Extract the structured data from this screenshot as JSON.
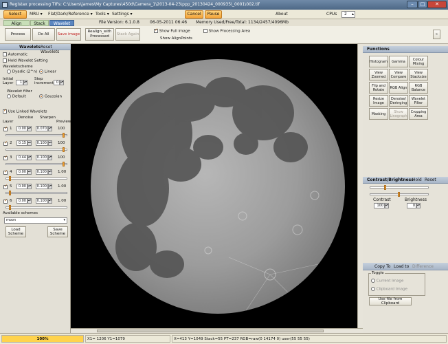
{
  "window": {
    "title": "Registax processing TIFs: C:\\Users\\james\\My Captures\\450d\\Camera_1\\2013-04-23\\ppp_20130424_000935\\_0001\\002.tif"
  },
  "menubar": {
    "select": "Select",
    "mru": "MRU",
    "flat": "Flat/Dark/Reference",
    "tools": "Tools",
    "settings": "Settings",
    "cancel": "Cancel",
    "pause": "Pause",
    "about": "About",
    "cpus_label": "CPUs",
    "cpus_value": "2"
  },
  "tabs": {
    "align": "Align",
    "stack": "Stack",
    "wavelet": "Wavelet",
    "file_version": "File Version: 6.1.0.8",
    "file_date": "06-05-2011 06:46",
    "memory": "Memory Used/Free/Total: 1134/2457/4096Mb"
  },
  "toolbar": {
    "process": "Process",
    "do_all": "Do All",
    "save_image": "Save image",
    "realign": "Realign_with Processed",
    "stack_again": "Stack Again",
    "show_full_image": "Show Full image",
    "show_processing_area": "Show Processing Area",
    "show_alignpoints": "Show AlignPoints",
    "expand": "»"
  },
  "wavelets": {
    "header": "Wavelets",
    "reset": "Reset Wavelets",
    "automatic": "Automatic",
    "hold_wavelet": "Hold Wavelet Setting",
    "scheme_label": "Waveletscheme",
    "dyadic": "Dyadic (2^n)",
    "linear": "Linear",
    "initial_layer_label": "Initial Layer",
    "initial_layer_value": "1",
    "step_increment_label": "Step increment",
    "step_increment_value": "0",
    "filter_label": "Wavelet filter",
    "default": "Default",
    "gaussian": "Gaussian",
    "use_linked": "Use Linked Wavelets",
    "col_layer": "Layer",
    "col_denoise": "Denoise",
    "col_sharpen": "Sharpen",
    "col_preview": "Preview",
    "layers": [
      {
        "n": "1",
        "denoise": "0.00",
        "sharpen": "0.070",
        "preview": "100",
        "level": 0.95
      },
      {
        "n": "2",
        "denoise": "0.15",
        "sharpen": "0.100",
        "preview": "100",
        "level": 0.95
      },
      {
        "n": "3",
        "denoise": "0.44",
        "sharpen": "0.100",
        "preview": "100",
        "level": 0.95
      },
      {
        "n": "4",
        "denoise": "0.00",
        "sharpen": "0.100",
        "preview": "1.00",
        "level": 0.05
      },
      {
        "n": "5",
        "denoise": "0.00",
        "sharpen": "0.100",
        "preview": "1.00",
        "level": 0.05
      },
      {
        "n": "6",
        "denoise": "0.00",
        "sharpen": "0.100",
        "preview": "1.00",
        "level": 0.05
      }
    ],
    "available_schemes": "Available schemes",
    "scheme_value": "moon",
    "load_scheme": "Load Scheme",
    "save_scheme": "Save Scheme"
  },
  "functions": {
    "header": "Functions",
    "buttons": [
      "Histogram",
      "Gamma",
      "Colour Mixing",
      "View Zoomed",
      "View Compare",
      "View Stacksize",
      "Flip and Rotate",
      "RGB Align",
      "RGB Balance",
      "Resize Image",
      "Denoise/ Deringing",
      "Wavelet Filter",
      "Masking",
      "Show Linegraph",
      "Cropping Area"
    ]
  },
  "contrast": {
    "header": "Contrast/Brightness",
    "hold": "Hold",
    "reset": "Reset",
    "contrast_label": "Contrast",
    "contrast_value": "100",
    "brightness_label": "Brightness",
    "brightness_value": "0"
  },
  "copy": {
    "copy_to": "Copy To",
    "load_to": "Load to",
    "difference": "Difference",
    "toggle_label": "Toggle",
    "current_image": "Current Image",
    "clipboard_image": "Clipboard Image",
    "use_file": "Use file from Clipboard"
  },
  "status": {
    "progress": "100%",
    "progress_fraction": 1.0,
    "xy": "X1= 1206 Y1=1079",
    "info": "X=413 Y=1049 Stack=55 PT=237 RGB=raw(0 14174 0) user(55 55 55)"
  }
}
